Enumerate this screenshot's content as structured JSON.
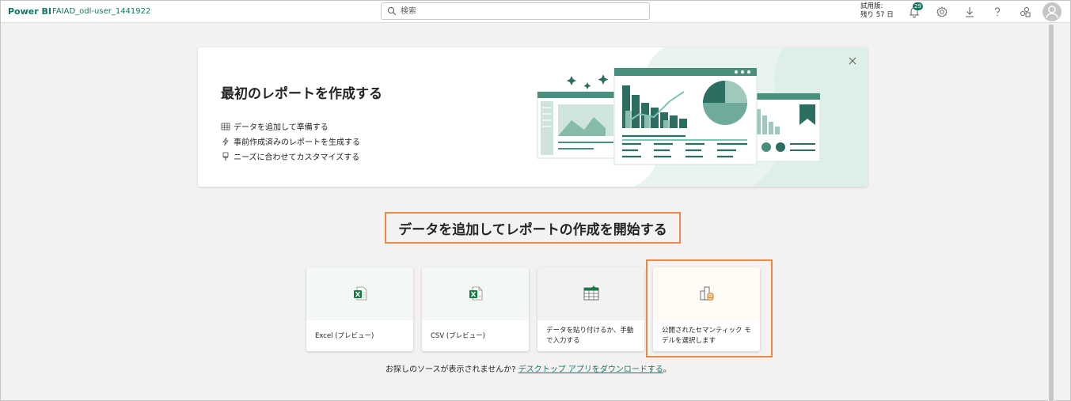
{
  "header": {
    "brand": "Power BI",
    "workspace": "FAIAD_odl-user_1441922",
    "search_placeholder": "検索",
    "trial_line1": "試用版:",
    "trial_line2": "残り 57 日",
    "notification_count": "29"
  },
  "banner": {
    "title": "最初のレポートを作成する",
    "features": [
      {
        "icon": "table-icon",
        "label": "データを追加して準備する"
      },
      {
        "icon": "sparkle-icon",
        "label": "事前作成済みのレポートを生成する"
      },
      {
        "icon": "brush-icon",
        "label": "ニーズに合わせてカスタマイズする"
      }
    ]
  },
  "section": {
    "heading": "データを追加してレポートの作成を開始する"
  },
  "cards": [
    {
      "icon": "excel-icon",
      "label": "Excel (プレビュー)"
    },
    {
      "icon": "csv-icon",
      "label": "CSV (プレビュー)"
    },
    {
      "icon": "table-entry-icon",
      "label": "データを貼り付けるか、手動で入力する"
    },
    {
      "icon": "semantic-model-icon",
      "label": "公開されたセマンティック モデルを選択します"
    }
  ],
  "footer": {
    "prefix": "お探しのソースが表示されませんか?",
    "link": "デスクトップ アプリをダウンロードする",
    "suffix": "。"
  },
  "colors": {
    "accent": "#117865",
    "highlight": "#e8884a"
  }
}
